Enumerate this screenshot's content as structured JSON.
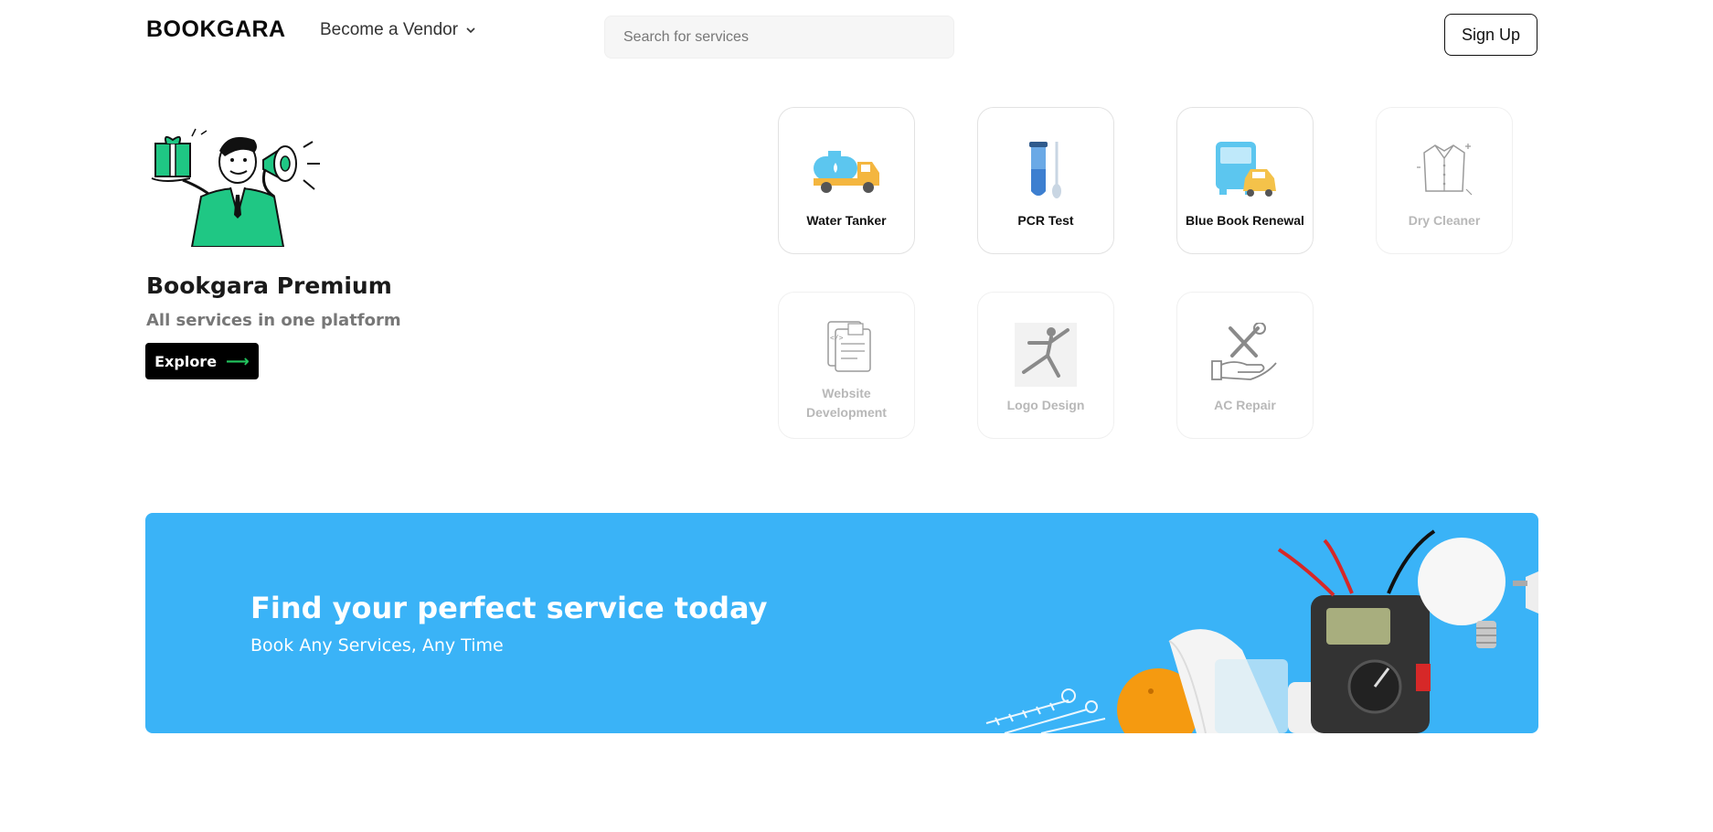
{
  "header": {
    "logo": "BOOKGARA",
    "vendor_label": "Become a Vendor",
    "search_placeholder": "Search for services",
    "signup_label": "Sign Up"
  },
  "promo": {
    "title": "Bookgara Premium",
    "subtitle": "All services in one platform",
    "explore_label": "Explore",
    "explore_arrow": "⟶"
  },
  "services": [
    {
      "label": "Water Tanker",
      "icon": "water-tanker-icon",
      "faded": false
    },
    {
      "label": "PCR Test",
      "icon": "pcr-test-icon",
      "faded": false
    },
    {
      "label": "Blue Book Renewal",
      "icon": "vehicles-icon",
      "faded": false
    },
    {
      "label": "Dry Cleaner",
      "icon": "shirt-icon",
      "faded": true
    },
    {
      "label": "Website Development",
      "icon": "web-docs-icon",
      "faded": true
    },
    {
      "label": "Logo Design",
      "icon": "dancer-icon",
      "faded": true
    },
    {
      "label": "AC Repair",
      "icon": "tools-hand-icon",
      "faded": true
    }
  ],
  "banner": {
    "title": "Find your perfect service today",
    "subtitle": "Book Any Services, Any Time"
  },
  "colors": {
    "banner_bg": "#3ab3f7",
    "accent_green": "#22c55e",
    "mascot_green": "#1fc784"
  }
}
